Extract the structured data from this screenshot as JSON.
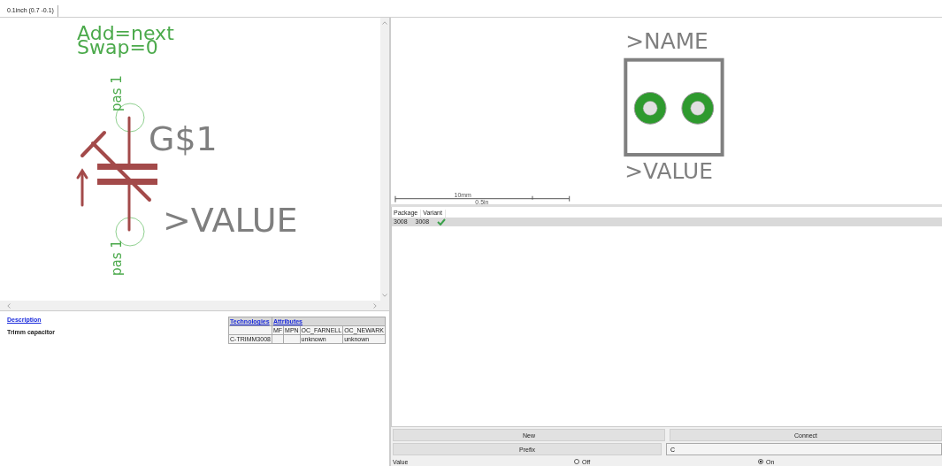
{
  "tab": {
    "label": "0.1inch (0.7 -0.1)",
    "selected": true
  },
  "symbol": {
    "add_label": "Add=next",
    "swap_label": "Swap=0",
    "pin_top": "pas 1",
    "pin_bottom": "pas 1",
    "name": "G$1",
    "value": ">VALUE"
  },
  "description": {
    "heading": "Description",
    "text": "Trimm capacitor"
  },
  "attributes": {
    "technologies_link": "Technologies",
    "attributes_link": "Attributes",
    "columns": [
      "MF",
      "MPN",
      "OC_FARNELL",
      "OC_NEWARK"
    ],
    "rows": [
      {
        "technology": "C-TRIMM3008",
        "values": {
          "OC_FARNELL": "unknown",
          "OC_NEWARK": "unknown"
        }
      }
    ]
  },
  "package_preview": {
    "name": ">NAME",
    "value": ">VALUE",
    "scale_mm": "10mm",
    "scale_in": "0.5in"
  },
  "packages": {
    "columns": [
      "Package",
      "Variant"
    ],
    "rows": [
      {
        "package": "3008",
        "variant": "3008",
        "connected": true,
        "selected": true
      }
    ]
  },
  "buttons": {
    "new": "New",
    "connect": "Connect",
    "prefix": "Prefix"
  },
  "prefix_value": "C",
  "value_row": {
    "label": "Value",
    "options": [
      {
        "label": "Off",
        "selected": false
      },
      {
        "label": "On",
        "selected": true
      }
    ]
  }
}
